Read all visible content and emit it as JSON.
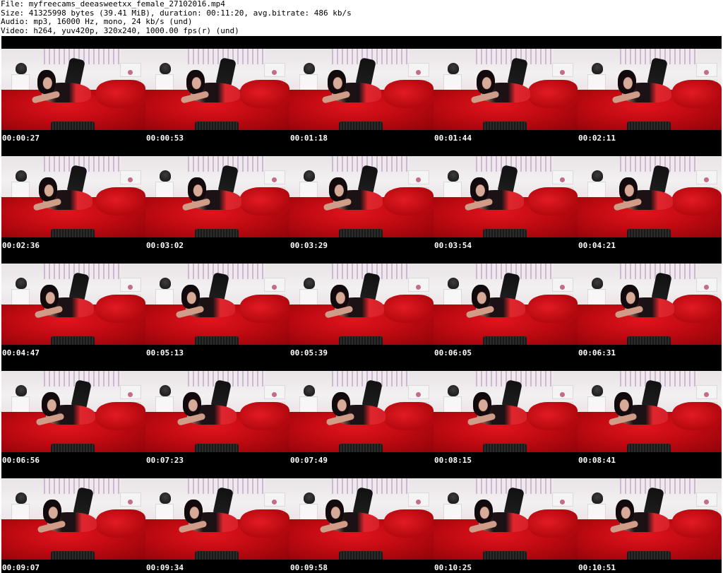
{
  "header": {
    "file_line": "File: myfreecams_deeasweetxx_female_27102016.mp4",
    "size_line": "Size: 41325998 bytes (39.41 MiB), duration: 00:11:20, avg.bitrate: 486 kb/s",
    "audio_line": "Audio: mp3, 16000 Hz, mono, 24 kb/s (und)",
    "video_line": "Video: h264, yuv420p, 320x240, 1000.00 fps(r) (und)"
  },
  "colors": {
    "background": "#ffffff",
    "grid_background": "#000000",
    "timestamp_text": "#ffffff",
    "header_text": "#000000",
    "bedding_red": "#c10a12"
  },
  "thumbnails": [
    {
      "time": "00:00:27"
    },
    {
      "time": "00:00:53"
    },
    {
      "time": "00:01:18"
    },
    {
      "time": "00:01:44"
    },
    {
      "time": "00:02:11"
    },
    {
      "time": "00:02:36"
    },
    {
      "time": "00:03:02"
    },
    {
      "time": "00:03:29"
    },
    {
      "time": "00:03:54"
    },
    {
      "time": "00:04:21"
    },
    {
      "time": "00:04:47"
    },
    {
      "time": "00:05:13"
    },
    {
      "time": "00:05:39"
    },
    {
      "time": "00:06:05"
    },
    {
      "time": "00:06:31"
    },
    {
      "time": "00:06:56"
    },
    {
      "time": "00:07:23"
    },
    {
      "time": "00:07:49"
    },
    {
      "time": "00:08:15"
    },
    {
      "time": "00:08:41"
    },
    {
      "time": "00:09:07"
    },
    {
      "time": "00:09:34"
    },
    {
      "time": "00:09:58"
    },
    {
      "time": "00:10:25"
    },
    {
      "time": "00:10:51"
    }
  ]
}
